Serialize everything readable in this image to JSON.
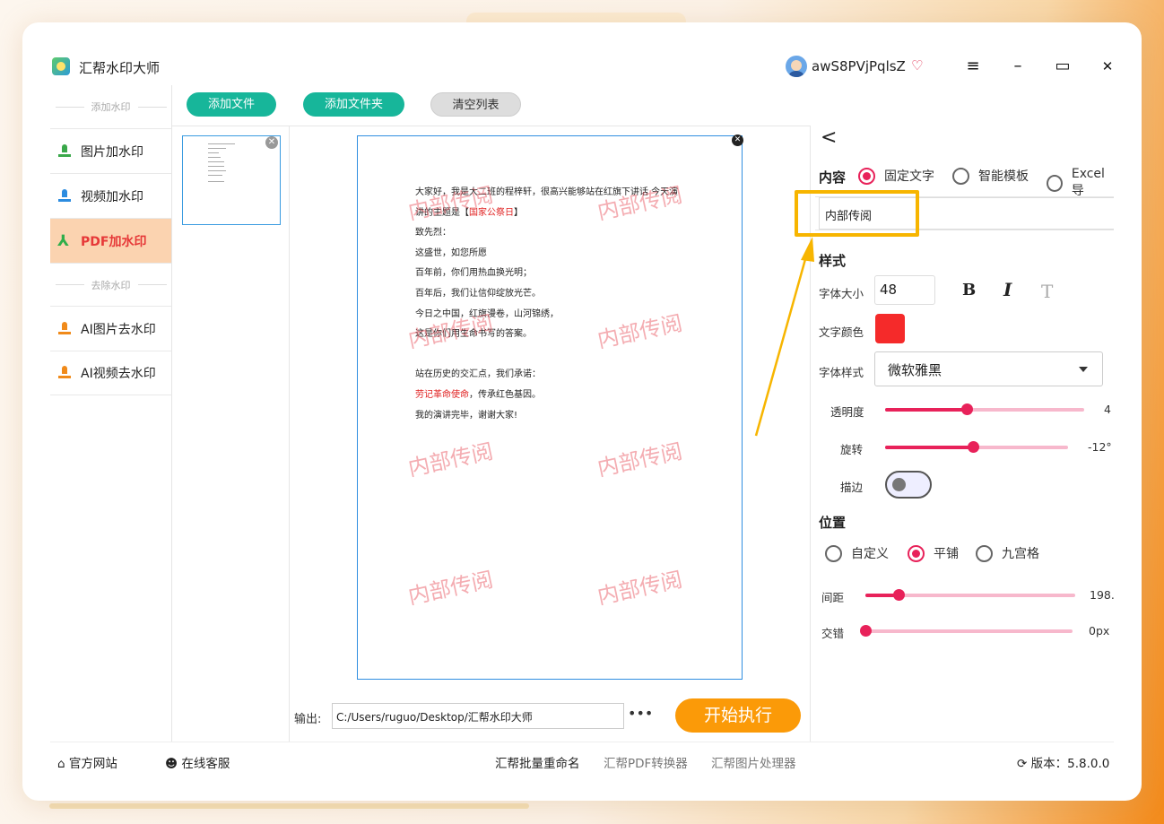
{
  "app": {
    "title": "汇帮水印大师"
  },
  "user": {
    "name": "awS8PVjPqlsZ",
    "vip_icon": "diamond-heart-icon"
  },
  "window_controls": {
    "menu": "≡",
    "minimize": "–",
    "maximize": "▭",
    "close": "✕"
  },
  "sidebar": {
    "section_add": "添加水印",
    "section_remove": "去除水印",
    "items": [
      {
        "label": "图片加水印",
        "icon": "image-watermark-icon"
      },
      {
        "label": "视频加水印",
        "icon": "video-watermark-icon"
      },
      {
        "label": "PDF加水印",
        "icon": "pdf-icon",
        "active": true
      },
      {
        "label": "AI图片去水印",
        "icon": "ai-image-remove-icon"
      },
      {
        "label": "AI视频去水印",
        "icon": "ai-video-remove-icon"
      }
    ]
  },
  "toolbar": {
    "add_file": "添加文件",
    "add_folder": "添加文件夹",
    "clear_list": "清空列表"
  },
  "preview": {
    "doc_lines": [
      {
        "parts": [
          {
            "t": "大家好，我是大二班的程梓轩，很高兴能够站在红旗下讲话 今天演"
          }
        ]
      },
      {
        "parts": [
          {
            "t": "讲的主题是【"
          },
          {
            "t": "国家公祭日",
            "red": true
          },
          {
            "t": "】"
          }
        ]
      },
      {
        "parts": [
          {
            "t": "致先烈："
          }
        ]
      },
      {
        "parts": [
          {
            "t": "这盛世，如您所愿"
          }
        ]
      },
      {
        "parts": [
          {
            "t": "百年前，你们用热血换光明；"
          }
        ]
      },
      {
        "parts": [
          {
            "t": "百年后，我们让信仰绽放光芒。"
          }
        ]
      },
      {
        "parts": [
          {
            "t": "今日之中国，红旗漫卷，山河锦绣，"
          }
        ]
      },
      {
        "parts": [
          {
            "t": "这是你们用生命书写的答案。"
          }
        ]
      },
      {
        "parts": [
          {
            "t": ""
          }
        ]
      },
      {
        "parts": [
          {
            "t": "站在历史的交汇点，我们承诺："
          }
        ]
      },
      {
        "parts": [
          {
            "t": "劳记革命使命",
            "red": true
          },
          {
            "t": "，传承红色基因。"
          }
        ]
      },
      {
        "parts": [
          {
            "t": "我的演讲完毕，谢谢大家!"
          }
        ]
      }
    ],
    "watermark_text": "内部传阅",
    "watermark_color": "#e8505a"
  },
  "output": {
    "label": "输出:",
    "path": "C:/Users/ruguo/Desktop/汇帮水印大师",
    "more": "•••",
    "run": "开始执行"
  },
  "panel": {
    "content_label": "内容",
    "content_options": [
      "固定文字",
      "智能模板",
      "Excel导"
    ],
    "content_selected": 0,
    "text_value": "内部传阅",
    "style_label": "样式",
    "font_size_label": "字体大小",
    "font_size": "48",
    "bold": "B",
    "italic": "I",
    "text_effect": "T",
    "text_color_label": "文字颜色",
    "text_color": "#f52a2a",
    "font_style_label": "字体样式",
    "font_family": "微软雅黑",
    "opacity_label": "透明度",
    "opacity_value": "4",
    "opacity_fraction": 0.41,
    "rotation_label": "旋转",
    "rotation_value": "-12°",
    "rotation_fraction": 0.48,
    "stroke_label": "描边",
    "stroke_on": false,
    "position_label": "位置",
    "position_options": [
      "自定义",
      "平铺",
      "九宫格"
    ],
    "position_selected": 1,
    "spacing_label": "间距",
    "spacing_value": "198.",
    "spacing_fraction": 0.16,
    "offset_label": "交错",
    "offset_value": "0px",
    "offset_fraction": 0.0
  },
  "footer": {
    "website": "官方网站",
    "support": "在线客服",
    "links": [
      "汇帮批量重命名",
      "汇帮PDF转换器",
      "汇帮图片处理器"
    ],
    "version": "版本：5.8.0.0"
  },
  "highlight_color": "#f7b500"
}
